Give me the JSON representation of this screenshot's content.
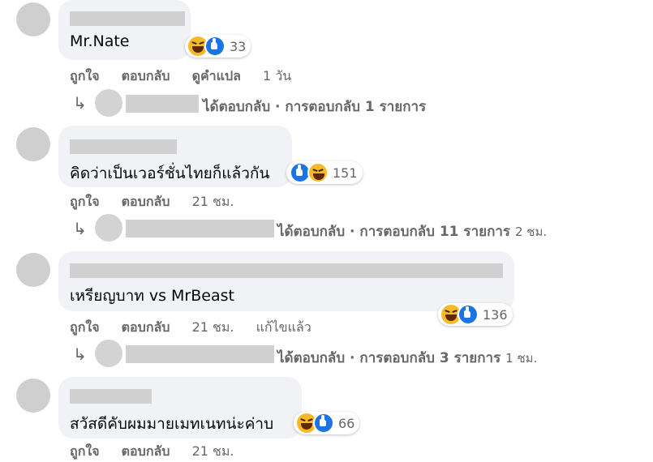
{
  "comments": [
    {
      "text": "Mr.Nate",
      "reactions": {
        "order": [
          "haha",
          "like"
        ],
        "count": "33"
      },
      "actions": {
        "like": "ถูกใจ",
        "reply": "ตอบกลับ",
        "translate": "ดูคำแปล",
        "time": "1 วัน"
      },
      "replies": {
        "summary": "ได้ตอบกลับ · การตอบกลับ 1 รายการ",
        "time": ""
      }
    },
    {
      "text": "คิดว่าเป็นเวอร์ชั่นไทยก็แล้วกัน",
      "reactions": {
        "order": [
          "like",
          "haha"
        ],
        "count": "151"
      },
      "actions": {
        "like": "ถูกใจ",
        "reply": "ตอบกลับ",
        "time": "21 ชม."
      },
      "replies": {
        "summary": "ได้ตอบกลับ · การตอบกลับ 11 รายการ",
        "time": "2 ชม."
      }
    },
    {
      "text": "เหรียญบาท vs MrBeast",
      "reactions": {
        "order": [
          "haha",
          "like"
        ],
        "count": "136"
      },
      "actions": {
        "like": "ถูกใจ",
        "reply": "ตอบกลับ",
        "time": "21 ชม.",
        "edited": "แก้ไขแล้ว"
      },
      "replies": {
        "summary": "ได้ตอบกลับ · การตอบกลับ 3 รายการ",
        "time": "1 ชม."
      }
    },
    {
      "text": "สวัสดีคับผมมายเมทเนทน่ะค่าบ",
      "reactions": {
        "order": [
          "haha",
          "like"
        ],
        "count": "66"
      },
      "actions": {
        "like": "ถูกใจ",
        "reply": "ตอบกลับ",
        "time": "21 ชม."
      }
    }
  ],
  "reply_arrow": "↳",
  "colors": {
    "bubble": "#f0f2f5",
    "meta": "#65676b",
    "like_blue": "#1b74e4",
    "haha_yellow": "#f7b928"
  }
}
